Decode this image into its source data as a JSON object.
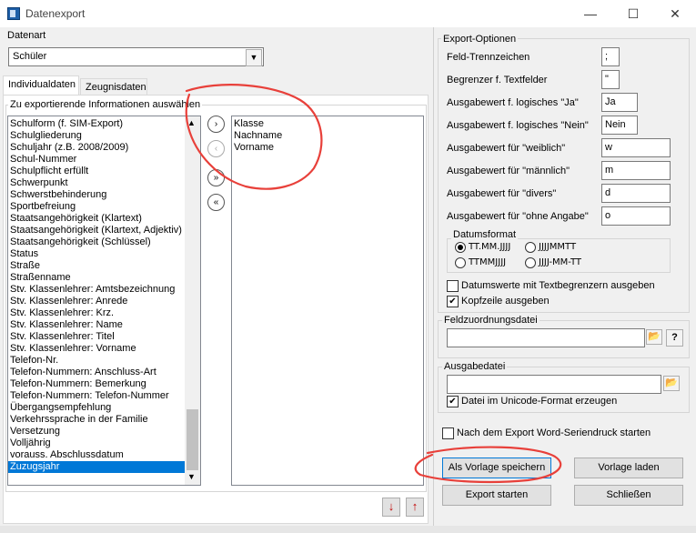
{
  "window": {
    "title": "Datenexport",
    "minimize": "—",
    "maximize": "☐",
    "close": "✕"
  },
  "datenart": {
    "label": "Datenart",
    "value": "Schüler"
  },
  "tabs": [
    {
      "label": "Individualdaten"
    },
    {
      "label": "Zeugnisdaten"
    }
  ],
  "info_group": {
    "title": "Zu exportierende Informationen auswählen"
  },
  "available_fields": [
    "Schulform (f. SIM-Export)",
    "Schulgliederung",
    "Schuljahr (z.B. 2008/2009)",
    "Schul-Nummer",
    "Schulpflicht erfüllt",
    "Schwerpunkt",
    "Schwerstbehinderung",
    "Sportbefreiung",
    "Staatsangehörigkeit (Klartext)",
    "Staatsangehörigkeit (Klartext, Adjektiv)",
    "Staatsangehörigkeit (Schlüssel)",
    "Status",
    "Straße",
    "Straßenname",
    "Stv. Klassenlehrer: Amtsbezeichnung",
    "Stv. Klassenlehrer: Anrede",
    "Stv. Klassenlehrer: Krz.",
    "Stv. Klassenlehrer: Name",
    "Stv. Klassenlehrer: Titel",
    "Stv. Klassenlehrer: Vorname",
    "Telefon-Nr.",
    "Telefon-Nummern: Anschluss-Art",
    "Telefon-Nummern: Bemerkung",
    "Telefon-Nummern: Telefon-Nummer",
    "Übergangsempfehlung",
    "Verkehrssprache in der Familie",
    "Versetzung",
    "Volljährig",
    "vorauss. Abschlussdatum",
    "Zuzugsjahr"
  ],
  "selected_field": "Zuzugsjahr",
  "chosen_fields": [
    "Klasse",
    "Nachname",
    "Vorname"
  ],
  "move_buttons": {
    "add": "›",
    "remove": "‹",
    "add_all": "»",
    "remove_all": "«"
  },
  "order_buttons": {
    "down": "↓",
    "up": "↑"
  },
  "options": {
    "title": "Export-Optionen",
    "fields": [
      {
        "label": "Feld-Trennzeichen",
        "value": ";"
      },
      {
        "label": "Begrenzer f. Textfelder",
        "value": "\""
      },
      {
        "label": "Ausgabewert f. logisches \"Ja\"",
        "value": "Ja"
      },
      {
        "label": "Ausgabewert f. logisches \"Nein\"",
        "value": "Nein"
      },
      {
        "label": "Ausgabewert für \"weiblich\"",
        "value": "w"
      },
      {
        "label": "Ausgabewert für \"männlich\"",
        "value": "m"
      },
      {
        "label": "Ausgabewert für \"divers\"",
        "value": "d"
      },
      {
        "label": "Ausgabewert für \"ohne Angabe\"",
        "value": "o"
      }
    ],
    "date_format": {
      "title": "Datumsformat",
      "options": [
        "TT.MM.JJJJ",
        "JJJJMMTT",
        "TTMMJJJJ",
        "JJJJ-MM-TT"
      ],
      "selected": "TT.MM.JJJJ"
    },
    "cb_datum": {
      "label": "Datumswerte mit Textbegrenzern ausgeben",
      "checked": false
    },
    "cb_kopf": {
      "label": "Kopfzeile ausgeben",
      "checked": true
    }
  },
  "mapping": {
    "title": "Feldzuordnungsdatei",
    "value": "",
    "help": "?"
  },
  "output": {
    "title": "Ausgabedatei",
    "value": "",
    "unicode_label": "Datei im Unicode-Format erzeugen",
    "unicode_checked": true
  },
  "word": {
    "label": "Nach dem Export Word-Seriendruck starten",
    "checked": false
  },
  "buttons": {
    "save_template": "Als Vorlage speichern",
    "load_template": "Vorlage laden",
    "start": "Export starten",
    "close": "Schließen"
  },
  "check_mark": "✔",
  "folder_icon": "📂",
  "colors": {
    "selection": "#0078d7",
    "annotation": "#e8403a"
  }
}
